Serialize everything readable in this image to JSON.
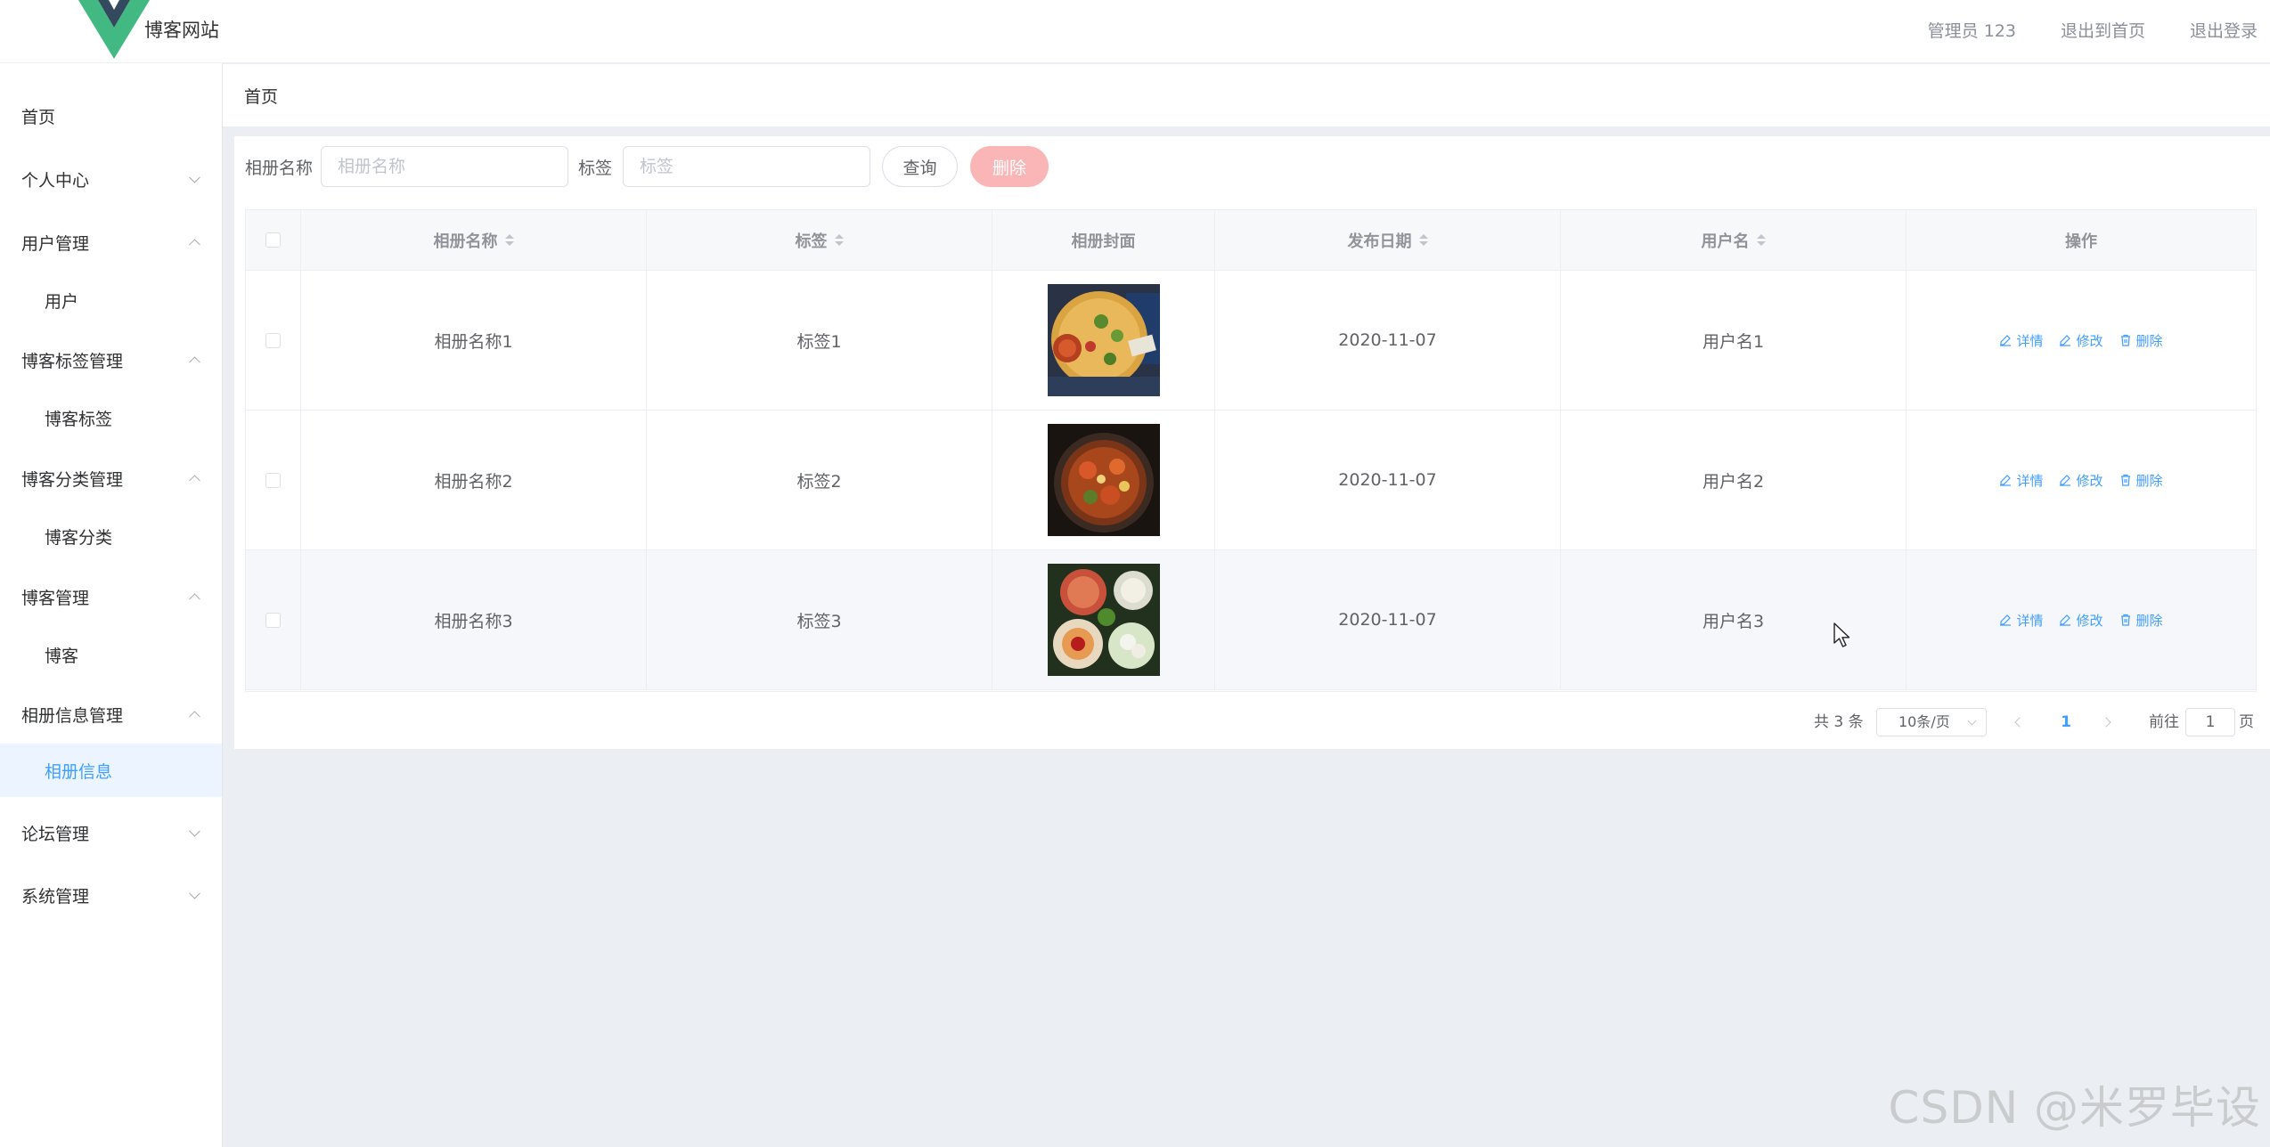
{
  "header": {
    "site_title": "博客网站",
    "admin_label": "管理员 123",
    "back_home": "退出到首页",
    "logout": "退出登录"
  },
  "sidebar": {
    "items": [
      {
        "label": "首页",
        "arrow": "none"
      },
      {
        "label": "个人中心",
        "arrow": "down"
      },
      {
        "label": "用户管理",
        "arrow": "up"
      },
      {
        "label": "用户",
        "arrow": "none"
      },
      {
        "label": "博客标签管理",
        "arrow": "up"
      },
      {
        "label": "博客标签",
        "arrow": "none"
      },
      {
        "label": "博客分类管理",
        "arrow": "up"
      },
      {
        "label": "博客分类",
        "arrow": "none"
      },
      {
        "label": "博客管理",
        "arrow": "up"
      },
      {
        "label": "博客",
        "arrow": "none"
      },
      {
        "label": "相册信息管理",
        "arrow": "up"
      },
      {
        "label": "相册信息",
        "arrow": "none"
      },
      {
        "label": "论坛管理",
        "arrow": "down"
      },
      {
        "label": "系统管理",
        "arrow": "down"
      }
    ]
  },
  "breadcrumb": "首页",
  "search": {
    "name_label": "相册名称",
    "name_placeholder": "相册名称",
    "tag_label": "标签",
    "tag_placeholder": "标签",
    "query_button": "查询",
    "delete_button": "删除"
  },
  "table": {
    "headers": {
      "name": "相册名称",
      "tag": "标签",
      "cover": "相册封面",
      "date": "发布日期",
      "user": "用户名",
      "ops": "操作"
    },
    "rows": [
      {
        "name": "相册名称1",
        "tag": "标签1",
        "cover": "food-photo-1",
        "date": "2020-11-07",
        "user": "用户名1"
      },
      {
        "name": "相册名称2",
        "tag": "标签2",
        "cover": "food-photo-2",
        "date": "2020-11-07",
        "user": "用户名2"
      },
      {
        "name": "相册名称3",
        "tag": "标签3",
        "cover": "food-photo-3",
        "date": "2020-11-07",
        "user": "用户名3"
      }
    ],
    "actions": {
      "detail": "详情",
      "edit": "修改",
      "delete": "删除"
    }
  },
  "pagination": {
    "total": "共 3 条",
    "page_size": "10条/页",
    "current_page": "1",
    "goto_label": "前往",
    "goto_value": "1",
    "page_suffix": "页"
  },
  "watermark": "CSDN @米罗毕设",
  "colors": {
    "accent": "#409eff",
    "logo_green": "#42b883",
    "logo_dark": "#35495e",
    "delete_disabled": "#fab6b6"
  }
}
